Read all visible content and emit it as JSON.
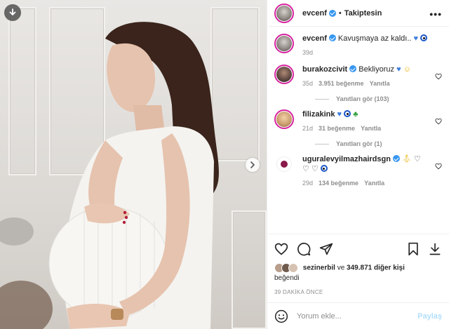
{
  "post": {
    "username": "evcenf",
    "follow_status": "Takiptesin",
    "more": "•••"
  },
  "caption": {
    "username": "evcenf",
    "text": "Kavuşmaya az kaldı..",
    "emoji": "💙🧿",
    "time": "39d"
  },
  "comments": [
    {
      "username": "burakozcivit",
      "verified": true,
      "text": "Bekliyoruz",
      "emoji": "💙😇",
      "time": "35d",
      "likes": "3.951 beğenme",
      "reply": "Yanıtla",
      "replies": "Yanıtları gör (103)"
    },
    {
      "username": "filizakink",
      "verified": false,
      "text": "",
      "emoji": "💙🧿🍀",
      "time": "21d",
      "likes": "31 beğenme",
      "reply": "Yanıtla",
      "replies": "Yanıtları gör (1)"
    },
    {
      "username": "uguralevyilmazhairdsgn",
      "verified": true,
      "text": "",
      "emoji": "🙏🤍🤍🤍🧿",
      "time": "29d",
      "likes": "134 beğenme",
      "reply": "Yanıtla"
    }
  ],
  "likes": {
    "liker": "sezinerbil",
    "connector": "ve",
    "others": "349.871 diğer kişi",
    "suffix": "beğendi"
  },
  "timestamp": "39 DAKİKA ÖNCE",
  "add_comment": {
    "placeholder": "Yorum ekle...",
    "post_label": "Paylaş"
  },
  "icons": {
    "download": "download-icon",
    "next": "chevron-right-icon",
    "like": "heart-icon",
    "comment": "comment-icon",
    "share": "paper-plane-icon",
    "save": "bookmark-icon",
    "emoji": "smiley-icon"
  }
}
